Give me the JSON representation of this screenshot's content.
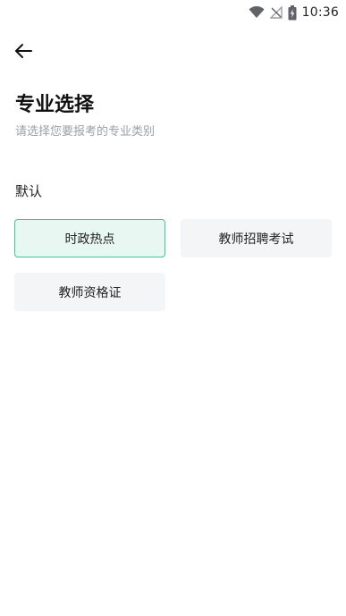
{
  "status_bar": {
    "time": "10:36",
    "icons": [
      "wifi-icon",
      "signal-off-icon",
      "battery-charging-icon"
    ]
  },
  "header": {
    "back_icon": "arrow-left-icon",
    "title": "专业选择",
    "subtitle": "请选择您要报考的专业类别"
  },
  "section": {
    "label": "默认",
    "options": [
      {
        "label": "时政热点",
        "selected": true
      },
      {
        "label": "教师招聘考试",
        "selected": false
      },
      {
        "label": "教师资格证",
        "selected": false
      }
    ]
  },
  "colors": {
    "accent": "#43c29a",
    "selected_bg": "#e8f7f1",
    "option_bg": "#f4f5f7"
  }
}
